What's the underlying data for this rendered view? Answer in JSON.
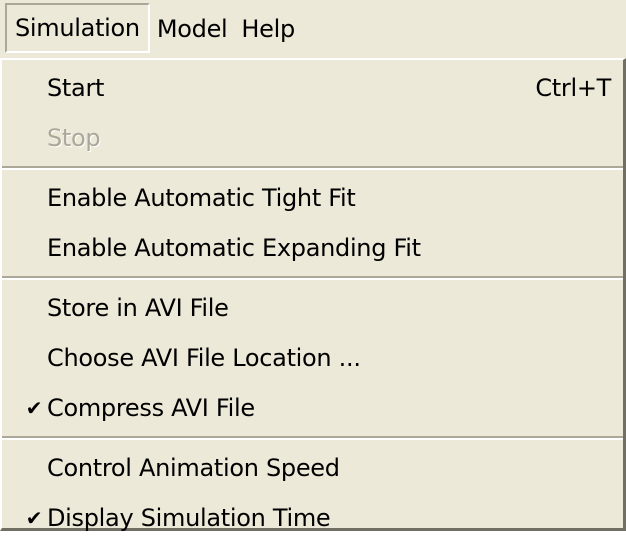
{
  "menubar": {
    "items": [
      {
        "label": "Simulation"
      },
      {
        "label": "Model"
      },
      {
        "label": "Help"
      }
    ]
  },
  "menu": {
    "start": {
      "label": "Start",
      "shortcut": "Ctrl+T"
    },
    "stop": {
      "label": "Stop",
      "enabled": false
    },
    "tight_fit": {
      "label": "Enable Automatic Tight Fit"
    },
    "expanding_fit": {
      "label": "Enable Automatic Expanding Fit"
    },
    "store_avi": {
      "label": "Store in AVI File"
    },
    "choose_avi": {
      "label": "Choose AVI File Location ..."
    },
    "compress_avi": {
      "label": "Compress AVI File",
      "checked": true,
      "check_glyph": "✔"
    },
    "control_speed": {
      "label": "Control Animation Speed"
    },
    "display_time": {
      "label": "Display Simulation Time",
      "checked": true,
      "check_glyph": "✔"
    }
  },
  "colors": {
    "menu_background": "#ece9d8",
    "disabled_text": "#aca899",
    "border_shadow": "#716f64"
  }
}
